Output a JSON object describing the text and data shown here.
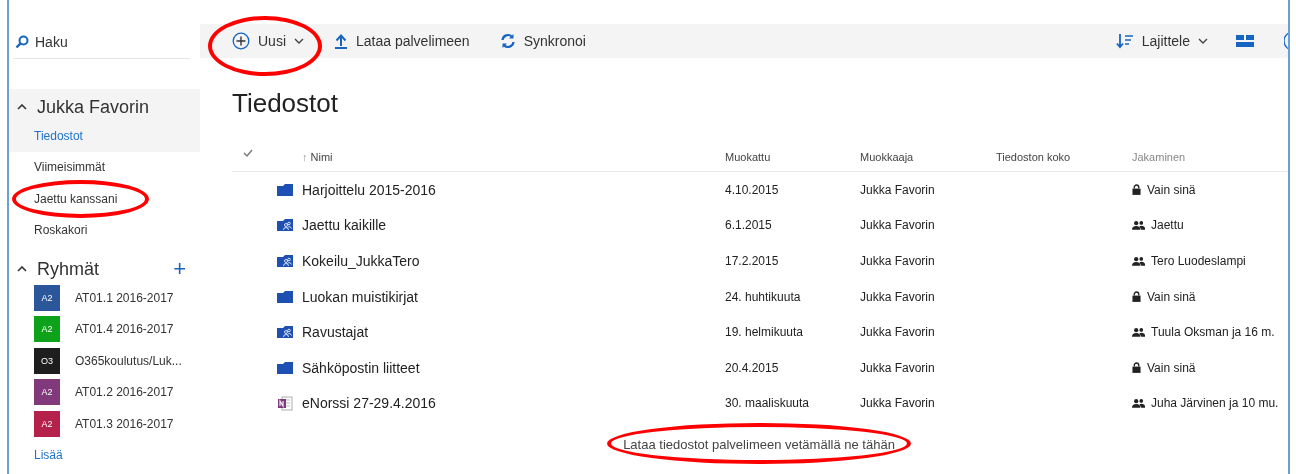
{
  "sidebar": {
    "search": {
      "placeholder": "Haku"
    },
    "account": {
      "name": "Jukka Favorin",
      "expanded": true
    },
    "nav": [
      {
        "label": "Tiedostot",
        "selected": true,
        "marked": false
      },
      {
        "label": "Viimeisimmät",
        "selected": false,
        "marked": false
      },
      {
        "label": "Jaettu kanssani",
        "selected": false,
        "marked": true
      },
      {
        "label": "Roskakori",
        "selected": false,
        "marked": false
      }
    ],
    "groups_header": {
      "label": "Ryhmät",
      "expanded": true,
      "add": "+"
    },
    "groups": [
      {
        "badge": "A2",
        "name": "AT01.1 2016-2017",
        "color": "#2b579a"
      },
      {
        "badge": "A2",
        "name": "AT01.4 2016-2017",
        "color": "#0ea21a"
      },
      {
        "badge": "O3",
        "name": "O365koulutus/Luk...",
        "color": "#1e1e1e"
      },
      {
        "badge": "A2",
        "name": "AT01.2 2016-2017",
        "color": "#80397b"
      },
      {
        "badge": "A2",
        "name": "AT01.3 2016-2017",
        "color": "#b4214b"
      }
    ],
    "more": "Lisää"
  },
  "toolbar": {
    "left": [
      {
        "kind": "new",
        "label": "Uusi",
        "marked": true
      },
      {
        "kind": "upload",
        "label": "Lataa palvelimeen",
        "marked": false
      },
      {
        "kind": "sync",
        "label": "Synkronoi",
        "marked": false
      }
    ],
    "sort": {
      "label": "Lajittele"
    }
  },
  "title": "Tiedostot",
  "table": {
    "sort_arrow": "↑",
    "columns": [
      "Nimi",
      "Muokattu",
      "Muokkaaja",
      "Tiedoston koko",
      "Jakaminen"
    ],
    "rows": [
      {
        "kind": "folder",
        "name": "Harjoittelu 2015-2016",
        "modified": "4.10.2015",
        "editor": "Jukka Favorin",
        "sharing": {
          "kind": "private",
          "label": "Vain sinä"
        }
      },
      {
        "kind": "shared-folder",
        "name": "Jaettu kaikille",
        "modified": "6.1.2015",
        "editor": "Jukka Favorin",
        "sharing": {
          "kind": "shared",
          "label": "Jaettu"
        }
      },
      {
        "kind": "shared-folder",
        "name": "Kokeilu_JukkaTero",
        "modified": "17.2.2015",
        "editor": "Jukka Favorin",
        "sharing": {
          "kind": "shared",
          "label": "Tero Luodeslampi"
        }
      },
      {
        "kind": "folder",
        "name": "Luokan muistikirjat",
        "modified": "24. huhtikuuta",
        "editor": "Jukka Favorin",
        "sharing": {
          "kind": "private",
          "label": "Vain sinä"
        }
      },
      {
        "kind": "shared-folder",
        "name": "Ravustajat",
        "modified": "19. helmikuuta",
        "editor": "Jukka Favorin",
        "sharing": {
          "kind": "shared",
          "label": "Tuula Oksman ja 16 m."
        }
      },
      {
        "kind": "folder",
        "name": "Sähköpostin liitteet",
        "modified": "20.4.2015",
        "editor": "Jukka Favorin",
        "sharing": {
          "kind": "private",
          "label": "Vain sinä"
        }
      },
      {
        "kind": "onenote",
        "name": "eNorssi 27-29.4.2016",
        "modified": "30. maaliskuuta",
        "editor": "Jukka Favorin",
        "sharing": {
          "kind": "shared",
          "label": "Juha Järvinen ja 10 mu."
        }
      }
    ]
  },
  "drop_hint": {
    "text": "Lataa tiedostot palvelimeen vetämällä ne tähän",
    "marked": true
  }
}
